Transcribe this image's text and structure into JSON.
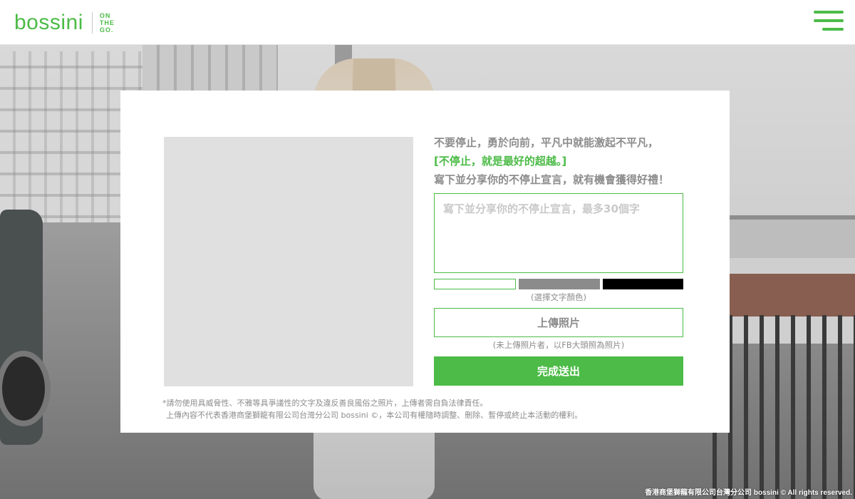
{
  "header": {
    "logo_text": "bossini",
    "tagline": [
      "ON",
      "THE",
      "GO."
    ],
    "menu_icon": "hamburger-menu-icon"
  },
  "modal": {
    "prompt_line1": "不要停止，勇於向前，平凡中就能激起不平凡，",
    "prompt_line2": "[不停止，就是最好的超越。]",
    "prompt_line3": "寫下並分享你的不停止宣言，就有機會獲得好禮！",
    "textarea_placeholder": "寫下並分享你的不停止宣言，最多30個字",
    "color_options": [
      "#ffffff",
      "#8b8b8b",
      "#000000"
    ],
    "color_hint": "(選擇文字顏色)",
    "upload_label": "上傳照片",
    "upload_hint": "(未上傳照片者，以FB大頭照為照片)",
    "submit_label": "完成送出",
    "disclaimer_line1": "*請勿使用具威脅性、不雅等具爭議性的文字及違反善良風俗之照片，上傳者需自負法律責任。",
    "disclaimer_line2": "上傳內容不代表香港商堡獅龍有限公司台灣分公司 bossini ©，本公司有權隨時調整、刪除、暫停或終止本活動的權利。"
  },
  "footer": {
    "copyright": "香港商堡獅龍有限公司台灣分公司 bossini © All rights reserved."
  },
  "colors": {
    "brand_green": "#4cbb47"
  }
}
